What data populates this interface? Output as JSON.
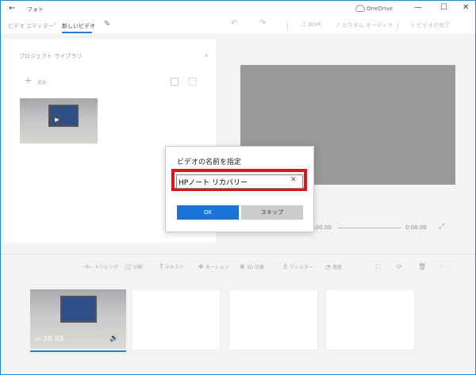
{
  "window": {
    "app_title": "フォト",
    "cloud_label": "OneDrive",
    "minimize_glyph": "—",
    "maximize_glyph": "☐",
    "close_glyph": "✕",
    "back_glyph": "←"
  },
  "toolbar": {
    "breadcrumb_parent": "ビデオ エディター",
    "breadcrumb_current": "新しいビデオ",
    "bgm": "BGM",
    "custom_audio": "カスタム オーディオ",
    "finish_video": "ビデオの完了"
  },
  "library": {
    "title": "プロジェクト ライブラリ",
    "add_label": "追加"
  },
  "player": {
    "time_start": "0:00.00",
    "time_end": "0:00.00"
  },
  "edit_tools": [
    {
      "label": "トリミング",
      "icon": "trim-icon",
      "glyph": "⊣⊢"
    },
    {
      "label": "分割",
      "icon": "split-icon",
      "glyph": "◫"
    },
    {
      "label": "テキスト",
      "icon": "text-icon",
      "glyph": "T"
    },
    {
      "label": "モーション",
      "icon": "motion-icon",
      "glyph": "✥"
    },
    {
      "label": "3D 効果",
      "icon": "3d-effects-icon",
      "glyph": "❋"
    },
    {
      "label": "フィルター",
      "icon": "filter-icon",
      "glyph": "♁"
    },
    {
      "label": "速度",
      "icon": "speed-icon",
      "glyph": "◔"
    }
  ],
  "storyboard": {
    "clip1_duration": "38.93"
  },
  "dialog": {
    "title": "ビデオの名前を指定",
    "input_value": "HPノート リカバリー",
    "ok_label": "OK",
    "skip_label": "スキップ"
  },
  "colors": {
    "accent": "#1a73d6",
    "highlight": "#e0141c"
  }
}
